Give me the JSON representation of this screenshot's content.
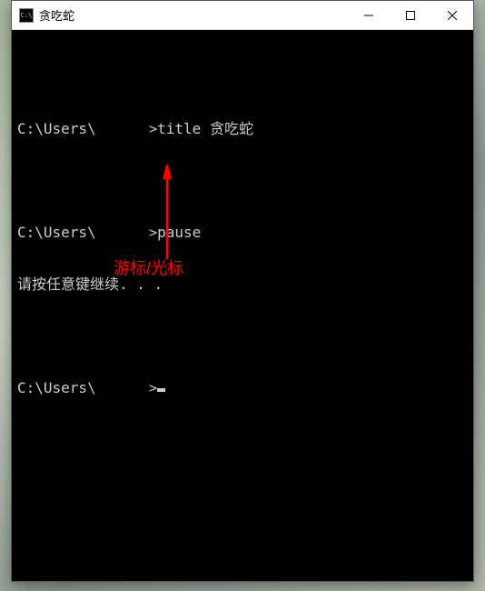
{
  "window": {
    "title": "贪吃蛇",
    "icon_label": "cmd-icon"
  },
  "controls": {
    "minimize": "—",
    "maximize": "☐",
    "close": "✕"
  },
  "terminal": {
    "prompt_prefix": "C:\\Users\\",
    "prompt_suffix": ">",
    "redacted_placeholder": "██████",
    "lines": [
      {
        "cmd": "title 贪吃蛇"
      },
      {
        "cmd": "pause"
      }
    ],
    "pause_message": "请按任意键继续. . ."
  },
  "annotation": {
    "label": "游标/光标",
    "color": "#ff0000"
  }
}
